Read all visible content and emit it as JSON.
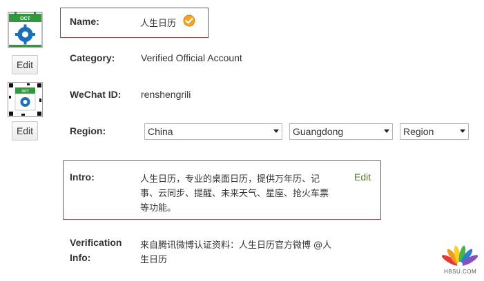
{
  "avatar": {
    "month_label": "OCT",
    "edit_label": "Edit"
  },
  "qr_avatar": {
    "month_label": "OCT",
    "edit_label": "Edit"
  },
  "name": {
    "label": "Name:",
    "value": "人生日历"
  },
  "category": {
    "label": "Category:",
    "value": "Verified Official Account"
  },
  "wechat_id": {
    "label": "WeChat ID:",
    "value": "renshengrili"
  },
  "region": {
    "label": "Region:",
    "country": "China",
    "province": "Guangdong",
    "city": "Region"
  },
  "intro": {
    "label": "Intro:",
    "line1": "人生日历，专业的桌面日历，提供万年历、记",
    "line2": "事、云同步、提醒、未来天气、星座、抢火车票",
    "line3": "等功能。",
    "edit_label": "Edit"
  },
  "verification": {
    "label_line1": "Verification",
    "label_line2": "Info:",
    "line1": "来自腾讯微博认证资料：人生日历官方微博 @人",
    "line2": "生日历"
  },
  "watermark": {
    "text": "HBSU.COM"
  },
  "colors": {
    "calendar_green": "#2f9a3c",
    "gear_blue": "#1a6fb8",
    "highlight_red": "#b43b3b",
    "edit_green": "#4f7a26",
    "verified_orange": "#f0a42a"
  }
}
